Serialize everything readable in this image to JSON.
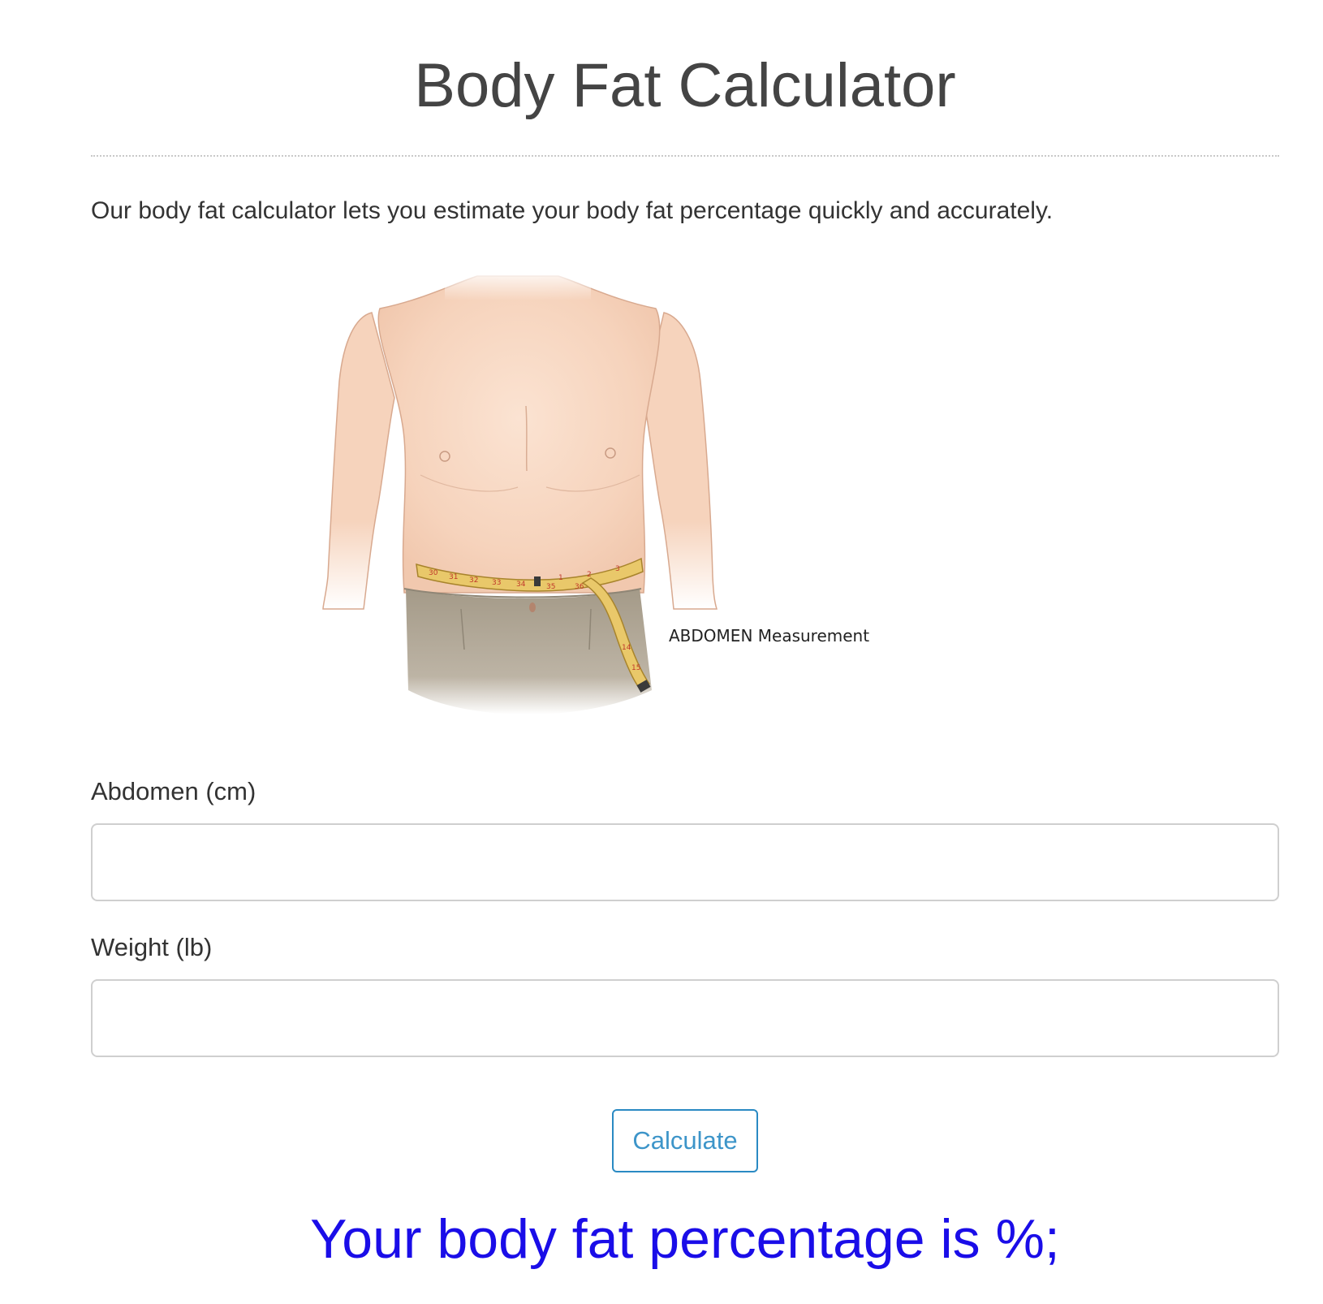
{
  "page": {
    "title": "Body Fat Calculator",
    "intro": "Our body fat calculator lets you estimate your body fat percentage quickly and accurately."
  },
  "illustration": {
    "caption": "ABDOMEN Measurement",
    "tape_numbers": [
      "30",
      "31",
      "32",
      "33",
      "34",
      "35",
      "36",
      "1",
      "2",
      "3",
      "14",
      "15"
    ]
  },
  "form": {
    "abdomen_label": "Abdomen (cm)",
    "abdomen_value": "",
    "weight_label": "Weight (lb)",
    "weight_value": "",
    "calculate_label": "Calculate"
  },
  "result": {
    "text": "Your body fat percentage is %;"
  },
  "colors": {
    "result_text": "#1a0de8",
    "button_border": "#2a8ac3",
    "skin": "#f7d9c4",
    "tape": "#e9c86a"
  }
}
